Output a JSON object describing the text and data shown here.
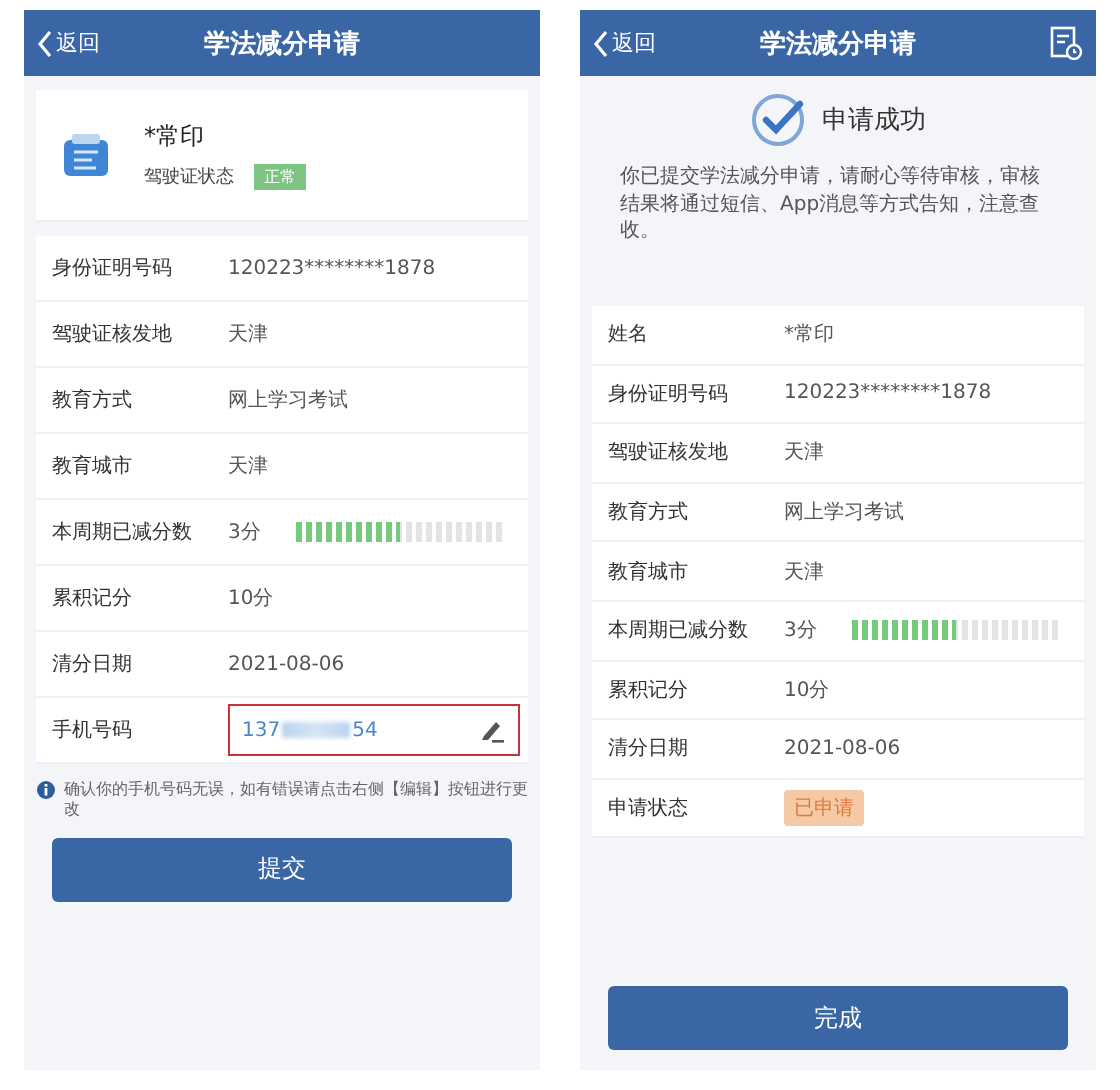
{
  "screens": [
    {
      "header": {
        "back": "返回",
        "title": "学法减分申请",
        "records_icon": false
      },
      "profile": {
        "name": "*常印",
        "status_label": "驾驶证状态",
        "status": "正常"
      },
      "rows": [
        {
          "kind": "text",
          "label": "身份证明号码",
          "value": "120223********1878"
        },
        {
          "kind": "text",
          "label": "驾驶证核发地",
          "value": "天津"
        },
        {
          "kind": "text",
          "label": "教育方式",
          "value": "网上学习考试"
        },
        {
          "kind": "text",
          "label": "教育城市",
          "value": "天津"
        },
        {
          "kind": "progress",
          "label": "本周期已减分数",
          "value": "3分",
          "level": 0.5
        },
        {
          "kind": "text",
          "label": "累积记分",
          "value": "10分"
        },
        {
          "kind": "text",
          "label": "清分日期",
          "value": "2021-08-06"
        },
        {
          "kind": "phone",
          "label": "手机号码",
          "prefix": "137",
          "suffix": "54",
          "highlighted": true
        }
      ],
      "note": "确认你的手机号码无误，如有错误请点击右侧【编辑】按钮进行更改",
      "button": "提交"
    },
    {
      "header": {
        "back": "返回",
        "title": "学法减分申请",
        "records_icon": true
      },
      "success": {
        "title": "申请成功",
        "message": "你已提交学法减分申请，请耐心等待审核，审核结果将通过短信、App消息等方式告知，注意查收。"
      },
      "rows": [
        {
          "kind": "text",
          "label": "姓名",
          "value": "*常印"
        },
        {
          "kind": "text",
          "label": "身份证明号码",
          "value": "120223********1878"
        },
        {
          "kind": "text",
          "label": "驾驶证核发地",
          "value": "天津"
        },
        {
          "kind": "text",
          "label": "教育方式",
          "value": "网上学习考试"
        },
        {
          "kind": "text",
          "label": "教育城市",
          "value": "天津"
        },
        {
          "kind": "progress",
          "label": "本周期已减分数",
          "value": "3分",
          "level": 0.5
        },
        {
          "kind": "text",
          "label": "累积记分",
          "value": "10分"
        },
        {
          "kind": "text",
          "label": "清分日期",
          "value": "2021-08-06"
        },
        {
          "kind": "badge",
          "label": "申请状态",
          "value": "已申请",
          "color": "#f5c9a6"
        }
      ],
      "button": "完成"
    }
  ]
}
